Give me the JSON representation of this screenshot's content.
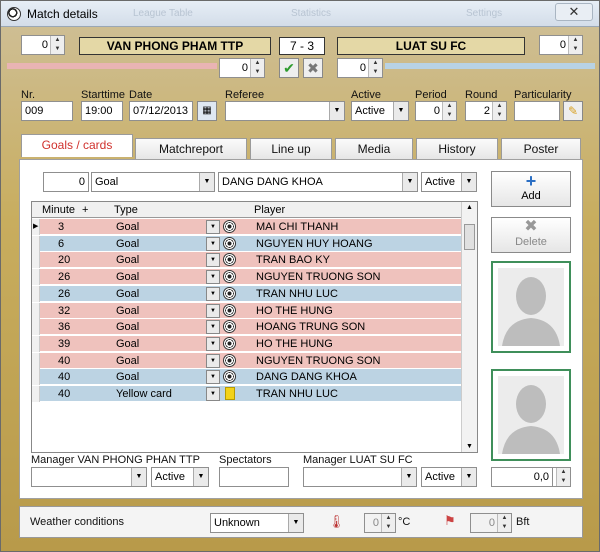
{
  "window": {
    "title": "Match details",
    "ghost_tabs": [
      "League Table",
      "Statistics",
      "Settings"
    ],
    "close": "✕"
  },
  "match": {
    "home_points": "0",
    "away_points": "0",
    "home_team": "VAN PHONG PHAM TTP",
    "away_team": "LUAT SU FC",
    "score": "7  - 3",
    "home_extra": "0",
    "away_extra": "0"
  },
  "header": {
    "nr_label": "Nr.",
    "nr": "009",
    "start_label": "Starttime",
    "start": "19:00",
    "date_label": "Date",
    "date": "07/12/2013",
    "referee_label": "Referee",
    "referee": "",
    "active_label": "Active",
    "active": "Active",
    "period_label": "Period",
    "period": "0",
    "round_label": "Round",
    "round": "2",
    "particularity_label": "Particularity",
    "particularity": ""
  },
  "tabs": [
    "Goals / cards",
    "Matchreport",
    "Line up",
    "Media",
    "History",
    "Poster"
  ],
  "filter": {
    "number": "0",
    "type": "Goal",
    "player": "DANG DANG KHOA",
    "status": "Active"
  },
  "buttons": {
    "add": "Add",
    "delete": "Delete"
  },
  "grid": {
    "headers": {
      "minute": "Minute",
      "plus": "+",
      "type": "Type",
      "player": "Player"
    },
    "rows": [
      {
        "minute": "3",
        "type": "Goal",
        "player": "MAI CHI THANH",
        "team": "home",
        "icon": "ball-icon"
      },
      {
        "minute": "6",
        "type": "Goal",
        "player": "NGUYEN HUY HOANG",
        "team": "away",
        "icon": "ball-icon"
      },
      {
        "minute": "20",
        "type": "Goal",
        "player": "TRAN BAO KY",
        "team": "home",
        "icon": "ball-icon"
      },
      {
        "minute": "26",
        "type": "Goal",
        "player": "NGUYEN TRUONG SON",
        "team": "home",
        "icon": "ball-icon"
      },
      {
        "minute": "26",
        "type": "Goal",
        "player": "TRAN NHU LUC",
        "team": "away",
        "icon": "ball-icon"
      },
      {
        "minute": "32",
        "type": "Goal",
        "player": "HO THE HUNG",
        "team": "home",
        "icon": "ball-icon"
      },
      {
        "minute": "36",
        "type": "Goal",
        "player": "HOANG TRUNG SON",
        "team": "home",
        "icon": "ball-icon"
      },
      {
        "minute": "39",
        "type": "Goal",
        "player": "HO THE HUNG",
        "team": "home",
        "icon": "ball-icon"
      },
      {
        "minute": "40",
        "type": "Goal",
        "player": "NGUYEN TRUONG SON",
        "team": "home",
        "icon": "ball-icon"
      },
      {
        "minute": "40",
        "type": "Goal",
        "player": "DANG DANG KHOA",
        "team": "away",
        "icon": "ball-icon"
      },
      {
        "minute": "40",
        "type": "Yellow card",
        "player": "TRAN NHU LUC",
        "team": "away",
        "icon": "yellow-card-icon"
      }
    ]
  },
  "bottom": {
    "home_manager_label": "Manager VAN PHONG PHAN TTP",
    "home_manager": "",
    "home_manager_status": "Active",
    "spectators_label": "Spectators",
    "spectators": "",
    "away_manager_label": "Manager LUAT SU FC",
    "away_manager": "",
    "away_manager_status": "Active",
    "rating": "0,0"
  },
  "weather": {
    "label": "Weather conditions",
    "value": "Unknown",
    "temp": "0",
    "temp_unit": "°C",
    "wind": "0",
    "wind_unit": "Bft"
  },
  "colors": {
    "home_row": "#efc2bd",
    "away_row": "#bcd3e3",
    "active_tab_text": "#d0312d"
  }
}
